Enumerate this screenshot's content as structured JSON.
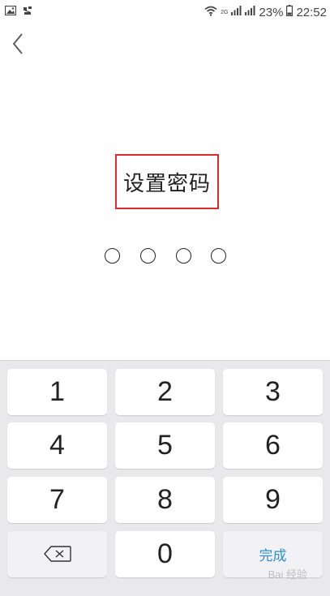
{
  "status_bar": {
    "network_label": "2G",
    "battery_percent": "23%",
    "time": "22:52",
    "icons": [
      "image-icon",
      "notification-icon",
      "wifi-icon",
      "signal-icon",
      "signal-icon",
      "battery-icon"
    ]
  },
  "header": {
    "back_icon": "chevron-left-icon"
  },
  "main": {
    "title": "设置密码",
    "pin_length": 4
  },
  "keypad": {
    "keys": [
      "1",
      "2",
      "3",
      "4",
      "5",
      "6",
      "7",
      "8",
      "9",
      "0"
    ],
    "backspace_icon": "backspace-icon",
    "done_label": "完成"
  },
  "watermark": "Bai 经验"
}
